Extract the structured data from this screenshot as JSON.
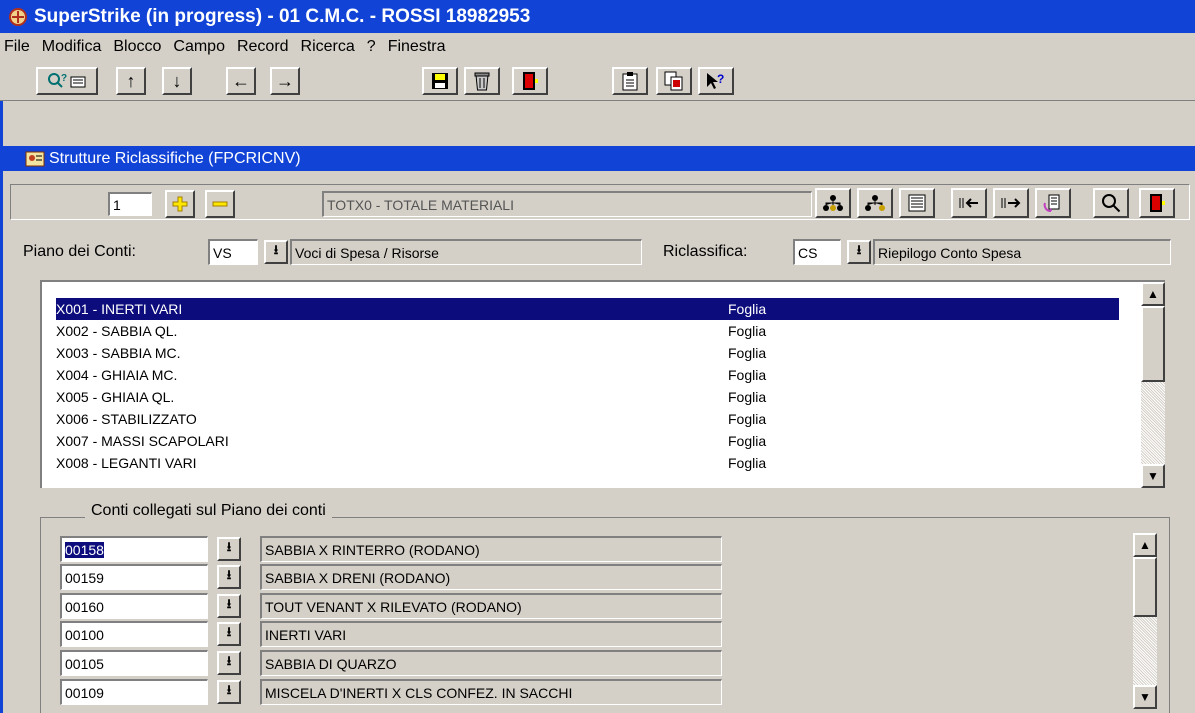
{
  "window": {
    "title": "SuperStrike (in progress) - 01 C.M.C. - ROSSI 18982953",
    "accent": "#1143d6"
  },
  "menu": [
    "File",
    "Modifica",
    "Blocco",
    "Campo",
    "Record",
    "Ricerca",
    "?",
    "Finestra"
  ],
  "form": {
    "title": "Strutture Riclassifiche (FPCRICNV)",
    "record_number": "1",
    "record_label": "TOTX0 - TOTALE MATERIALI"
  },
  "piano": {
    "label": "Piano dei Conti:",
    "code": "VS",
    "desc": "Voci di Spesa / Risorse"
  },
  "riclassifica": {
    "label": "Riclassifica:",
    "code": "CS",
    "desc": "Riepilogo Conto Spesa"
  },
  "list": {
    "rows": [
      {
        "code": "X001 - INERTI VARI",
        "type": "Foglia"
      },
      {
        "code": "X002 - SABBIA QL.",
        "type": "Foglia"
      },
      {
        "code": "X003 - SABBIA MC.",
        "type": "Foglia"
      },
      {
        "code": "X004 - GHIAIA MC.",
        "type": "Foglia"
      },
      {
        "code": "X005 - GHIAIA QL.",
        "type": "Foglia"
      },
      {
        "code": "X006 - STABILIZZATO",
        "type": "Foglia"
      },
      {
        "code": "X007 - MASSI SCAPOLARI",
        "type": "Foglia"
      },
      {
        "code": "X008 - LEGANTI VARI",
        "type": "Foglia"
      }
    ],
    "selected_color": "#0c0c7c"
  },
  "conti": {
    "title": "Conti collegati sul Piano dei conti",
    "rows": [
      {
        "code": "00158",
        "desc": "SABBIA X RINTERRO (RODANO)"
      },
      {
        "code": "00159",
        "desc": "SABBIA X DRENI (RODANO)"
      },
      {
        "code": "00160",
        "desc": "TOUT VENANT X RILEVATO (RODANO)"
      },
      {
        "code": "00100",
        "desc": "INERTI VARI"
      },
      {
        "code": "00105",
        "desc": "SABBIA DI QUARZO"
      },
      {
        "code": "00109",
        "desc": "MISCELA D'INERTI X CLS CONFEZ. IN SACCHI"
      }
    ]
  },
  "icons": {
    "toolbar": [
      "query-icon",
      "up-arrow-icon",
      "down-arrow-icon",
      "left-arrow-icon",
      "right-arrow-icon",
      "save-icon",
      "delete-icon",
      "exit-icon",
      "clipboard-icon",
      "copy-icon",
      "help-icon"
    ],
    "nav": [
      "add-icon",
      "remove-icon",
      "tree-expand-icon",
      "tree-collapse-icon",
      "list-icon",
      "move-in-icon",
      "move-out-icon",
      "refresh-icon",
      "search-icon",
      "exit-icon"
    ]
  }
}
